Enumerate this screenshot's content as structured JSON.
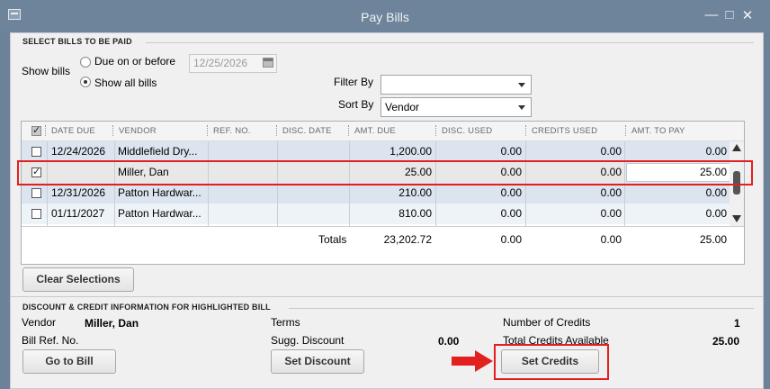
{
  "window": {
    "title": "Pay Bills",
    "controls": [
      "minimize-icon",
      "maximize-icon",
      "close-icon"
    ]
  },
  "select_section": {
    "heading": "SELECT BILLS TO BE PAID",
    "show_bills_label": "Show bills",
    "option_due": "Due on or before",
    "option_all": "Show all bills",
    "selected_option": "Show all bills",
    "due_date_value": "12/25/2026",
    "filter_by_label": "Filter By",
    "filter_by_value": "",
    "sort_by_label": "Sort By",
    "sort_by_value": "Vendor"
  },
  "table": {
    "columns": [
      "DATE DUE",
      "VENDOR",
      "REF. NO.",
      "DISC. DATE",
      "AMT. DUE",
      "DISC. USED",
      "CREDITS USED",
      "AMT. TO PAY"
    ],
    "rows": [
      {
        "checked": false,
        "date_due": "12/24/2026",
        "vendor": "Middlefield Dry...",
        "ref_no": "",
        "disc_date": "",
        "amt_due": "1,200.00",
        "disc_used": "0.00",
        "credits_used": "0.00",
        "amt_to_pay": "0.00"
      },
      {
        "checked": true,
        "date_due": "",
        "vendor": "Miller, Dan",
        "ref_no": "",
        "disc_date": "",
        "amt_due": "25.00",
        "disc_used": "0.00",
        "credits_used": "0.00",
        "amt_to_pay": "25.00"
      },
      {
        "checked": false,
        "date_due": "12/31/2026",
        "vendor": "Patton Hardwar...",
        "ref_no": "",
        "disc_date": "",
        "amt_due": "210.00",
        "disc_used": "0.00",
        "credits_used": "0.00",
        "amt_to_pay": "0.00"
      },
      {
        "checked": false,
        "date_due": "01/11/2027",
        "vendor": "Patton Hardwar...",
        "ref_no": "",
        "disc_date": "",
        "amt_due": "810.00",
        "disc_used": "0.00",
        "credits_used": "0.00",
        "amt_to_pay": "0.00"
      }
    ],
    "totals_label": "Totals",
    "totals": {
      "amt_due": "23,202.72",
      "disc_used": "0.00",
      "credits_used": "0.00",
      "amt_to_pay": "25.00"
    }
  },
  "clear_selections_label": "Clear Selections",
  "discount_section": {
    "heading": "DISCOUNT & CREDIT INFORMATION FOR HIGHLIGHTED BILL",
    "vendor_label": "Vendor",
    "vendor_value": "Miller, Dan",
    "bill_ref_label": "Bill Ref. No.",
    "terms_label": "Terms",
    "terms_value": "",
    "sugg_discount_label": "Sugg. Discount",
    "sugg_discount_value": "0.00",
    "num_credits_label": "Number of Credits",
    "num_credits_value": "1",
    "total_credits_label": "Total Credits Available",
    "total_credits_value": "25.00",
    "go_to_bill_label": "Go to Bill",
    "set_discount_label": "Set Discount",
    "set_credits_label": "Set Credits"
  },
  "colors": {
    "annotation_red": "#e32020",
    "titlebar": "#6e849a",
    "row_highlight": "#dbe4ef"
  }
}
